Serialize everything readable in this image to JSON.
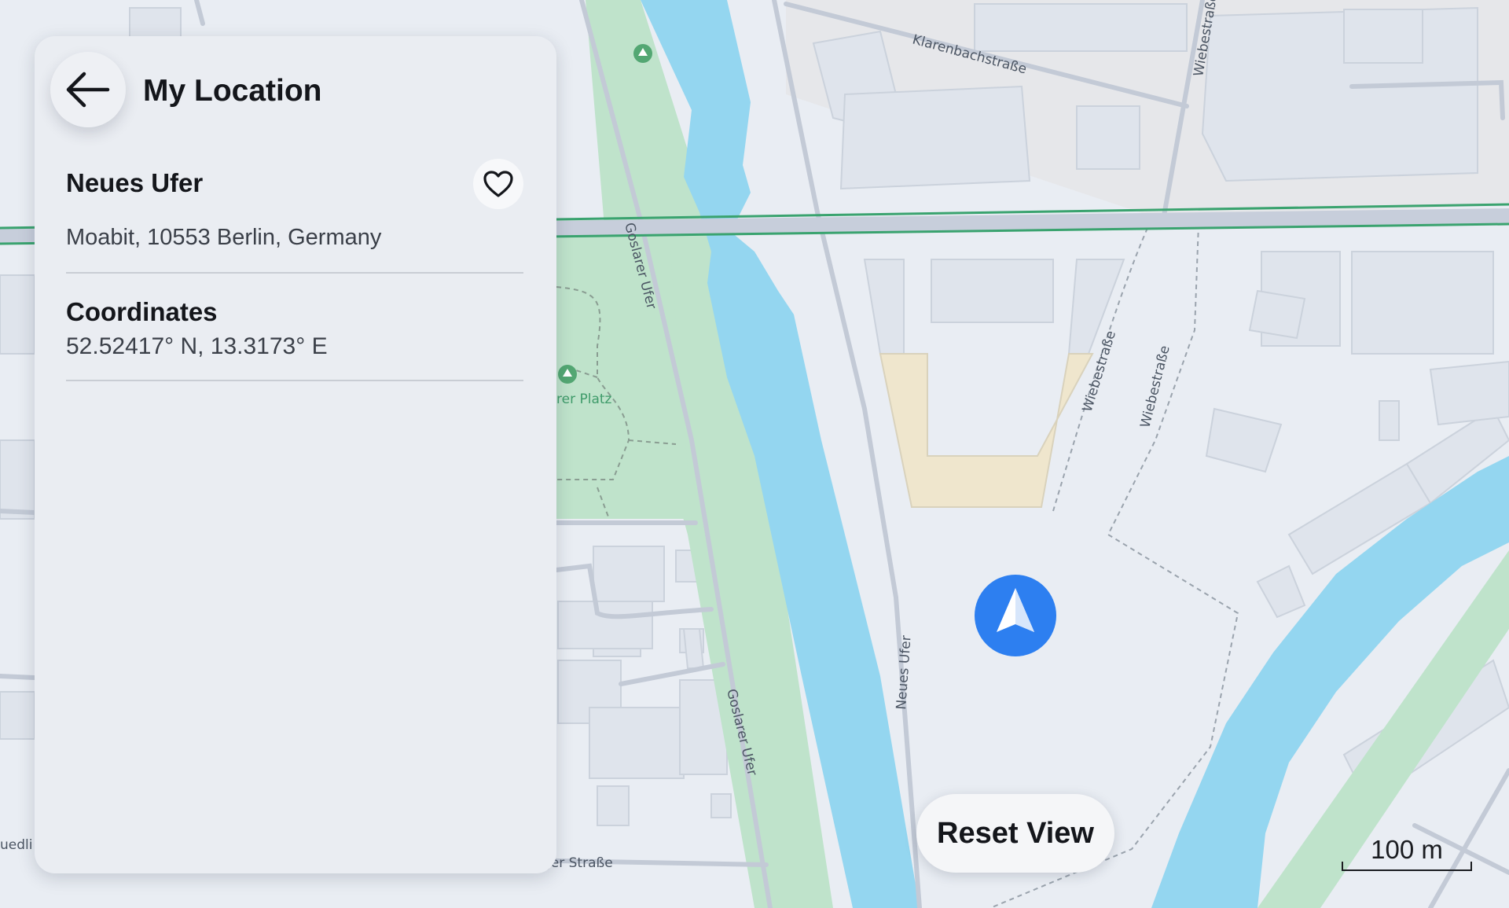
{
  "panel": {
    "title": "My Location",
    "place_name": "Neues Ufer",
    "address": "Moabit, 10553 Berlin, Germany",
    "coordinates_heading": "Coordinates",
    "coordinates_value": "52.52417° N, 13.3173° E",
    "back_icon": "arrow-left-icon",
    "favorite_icon": "heart-outline-icon"
  },
  "map": {
    "street_labels": {
      "klarenbachstrasse": "Klarenbachstraße",
      "wiebestrasse_top": "Wiebestraße",
      "goslarer_ufer_top": "Goslarer Ufer",
      "wiebestrasse_mid_1": "Wiebestraße",
      "wiebestrasse_mid_2": "Wiebestraße",
      "park_label": "rer Platz",
      "neues_ufer": "Neues Ufer",
      "goslarer_ufer_bottom": "Goslarer Ufer",
      "bottom_street": "ger Straße",
      "left_edge": "uedli"
    },
    "location_marker_icon": "navigation-arrow-icon",
    "colors": {
      "water": "#94d6f0",
      "park": "#bfe3cb",
      "rail": "#3aa36f",
      "marker": "#2d7ff0"
    }
  },
  "controls": {
    "reset_view": "Reset View",
    "scale_label": "100 m"
  }
}
